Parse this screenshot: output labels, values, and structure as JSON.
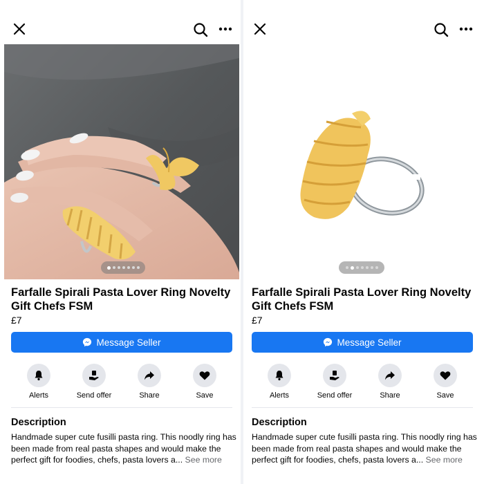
{
  "listing": {
    "title": "Farfalle Spirali Pasta Lover Ring Novelty Gift Chefs FSM",
    "price": "£7",
    "message_button": "Message Seller",
    "actions": {
      "alerts": "Alerts",
      "send_offer": "Send offer",
      "share": "Share",
      "save": "Save"
    },
    "description_heading": "Description",
    "description_text": "Handmade super cute fusilli pasta ring. This noodly ring has been made from real pasta shapes and would make the perfect gift for foodies, chefs, pasta lovers a...",
    "see_more": "See more"
  },
  "carousel": {
    "image_count": 7,
    "left_active_index": 0,
    "right_active_index": 1
  },
  "icons": {
    "close": "close-icon",
    "search": "search-icon",
    "more": "more-icon",
    "messenger": "messenger-icon",
    "alerts": "bell-icon",
    "send_offer": "offer-icon",
    "share": "share-arrow-icon",
    "save": "heart-icon"
  },
  "colors": {
    "accent": "#1877f2",
    "icon_bg": "#e4e6eb",
    "secondary_text": "#65676b"
  }
}
